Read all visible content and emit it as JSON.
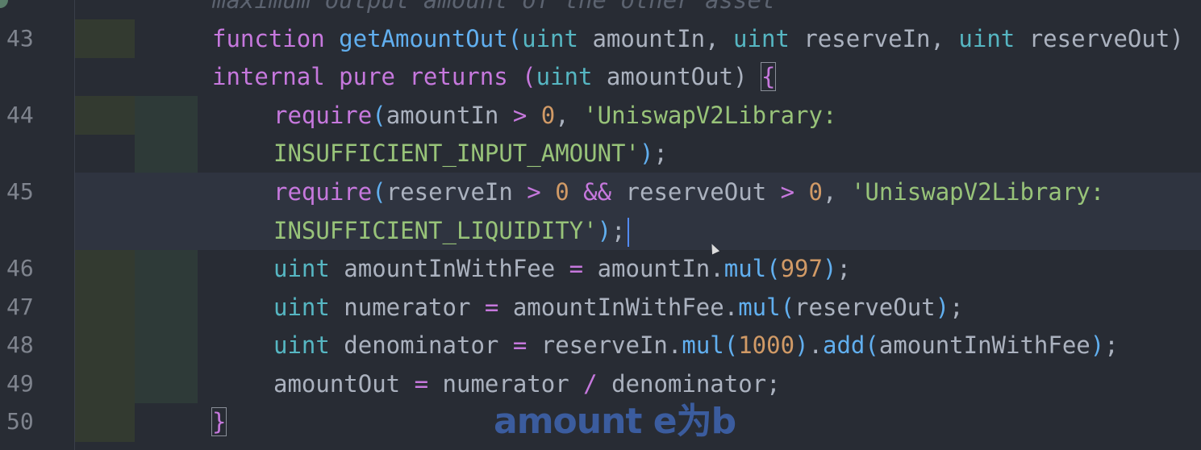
{
  "editor": {
    "comment_line": "maximum output amount of the other asset",
    "line_numbers": [
      "43",
      "44",
      "45",
      "46",
      "47",
      "48",
      "49",
      "50"
    ],
    "lines": {
      "l43a": {
        "kw_function": "function",
        "name": "getAmountOut",
        "p_open": "(",
        "t1": "uint",
        "a1": " amountIn, ",
        "t2": "uint",
        "a2": " reserveIn, ",
        "t3": "uint",
        "a3": " reserveOut)"
      },
      "l43b": {
        "kw_internal": "internal",
        "kw_pure": "pure",
        "kw_returns": "returns",
        "p_open": "(",
        "t": "uint",
        "ret": " amountOut) ",
        "brace": "{"
      },
      "l44a": {
        "fn": "require",
        "p_open": "(",
        "arg": "amountIn ",
        "op": ">",
        "num": "0",
        "comma": ", ",
        "str": "'UniswapV2Library:"
      },
      "l44b": {
        "str": "INSUFFICIENT_INPUT_AMOUNT'",
        "p_close": ")",
        "semi": ";"
      },
      "l45a": {
        "fn": "require",
        "p_open": "(",
        "arg1": "reserveIn ",
        "op1": ">",
        "num1": "0",
        "op2": "&&",
        "arg2": " reserveOut ",
        "op3": ">",
        "num2": "0",
        "comma": ", ",
        "str": "'UniswapV2Library:"
      },
      "l45b": {
        "str": "INSUFFICIENT_LIQUIDITY'",
        "p_close": ")",
        "semi": ";"
      },
      "l46": {
        "t": "uint",
        "var": " amountInWithFee ",
        "eq": "=",
        "obj": " amountIn.",
        "fn": "mul",
        "p_open": "(",
        "num": "997",
        "p_close": ")",
        "semi": ";"
      },
      "l47": {
        "t": "uint",
        "var": " numerator ",
        "eq": "=",
        "obj": " amountInWithFee.",
        "fn": "mul",
        "p_open": "(",
        "arg": "reserveOut",
        "p_close": ")",
        "semi": ";"
      },
      "l48": {
        "t": "uint",
        "var": " denominator ",
        "eq": "=",
        "obj": " reserveIn.",
        "fn1": "mul",
        "p1_open": "(",
        "num": "1000",
        "p1_close": ")",
        "dot": ".",
        "fn2": "add",
        "p2_open": "(",
        "arg": "amountInWithFee",
        "p2_close": ")",
        "semi": ";"
      },
      "l49": {
        "var": "amountOut ",
        "eq": "=",
        "a": " numerator ",
        "div": "/",
        "b": " denominator;"
      },
      "l50": {
        "brace": "}"
      }
    }
  },
  "subtitle": "amount e为b"
}
